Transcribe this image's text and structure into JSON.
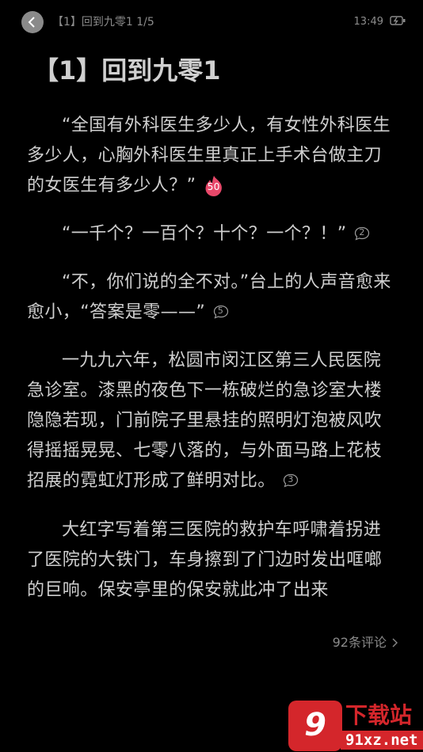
{
  "header": {
    "title": "【1】回到九零1 1/5",
    "time": "13:49"
  },
  "chapter": {
    "title": "【1】回到九零1"
  },
  "paragraphs": [
    {
      "text": "“全国有外科医生多少人，有女性外科医生多少人，心胸外科医生里真正上手术台做主刀的女医生有多少人？”",
      "comment_count": "50",
      "hot": true
    },
    {
      "text": "“一千个？一百个？十个？一个？！”",
      "comment_count": "2",
      "hot": false
    },
    {
      "text": "“不，你们说的全不对。”台上的人声音愈来愈小，“答案是零——”",
      "comment_count": "5",
      "hot": false
    },
    {
      "text": "一九九六年，松圆市闵江区第三人民医院急诊室。漆黑的夜色下一栋破烂的急诊室大楼隐隐若现，门前院子里悬挂的照明灯泡被风吹得摇摇晃晃、七零八落的，与外面马路上花枝招展的霓虹灯形成了鲜明对比。",
      "comment_count": "3",
      "hot": false
    },
    {
      "text": "大红字写着第三医院的救护车呼啸着拐进了医院的大铁门，车身擦到了门边时发出哐啷的巨响。保安亭里的保安就此冲了出来",
      "comment_count": null,
      "hot": false
    }
  ],
  "comments_link": {
    "label": "92条评论"
  },
  "watermark": {
    "logo": "9",
    "text": "下载站",
    "url": "91xz.net"
  },
  "colors": {
    "background": "#000000",
    "text": "#cfcfcf",
    "muted": "#8c8c8c",
    "hot_badge": "#e8486a",
    "watermark": "#d4262b"
  }
}
